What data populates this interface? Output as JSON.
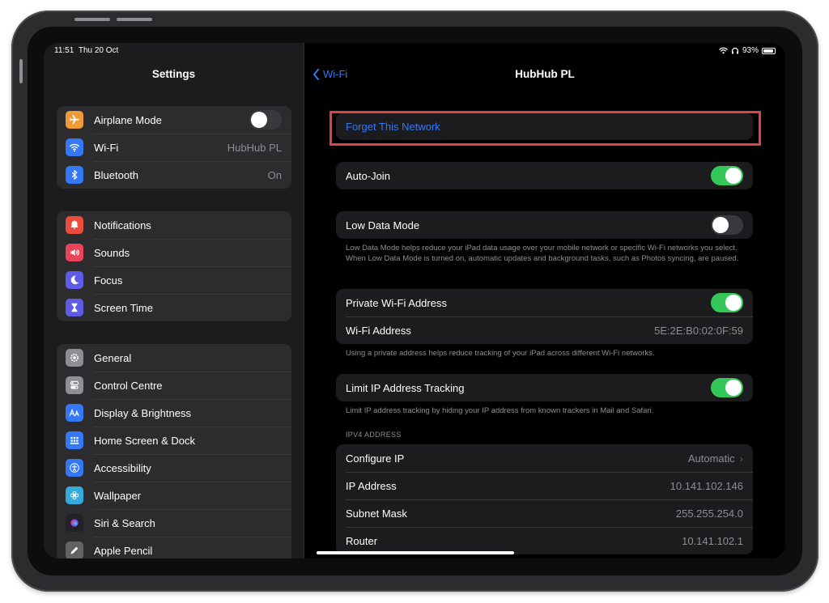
{
  "status_bar": {
    "time": "11:51",
    "date": "Thu 20 Oct",
    "battery": "93%"
  },
  "sidebar": {
    "title": "Settings",
    "groups": [
      [
        {
          "label": "Airplane Mode",
          "icon": "airplane-icon",
          "color": "#f09a37",
          "toggle": "off"
        },
        {
          "label": "Wi-Fi",
          "icon": "wifi-icon",
          "color": "#3478f6",
          "value": "HubHub PL"
        },
        {
          "label": "Bluetooth",
          "icon": "bluetooth-icon",
          "color": "#3478f6",
          "value": "On"
        }
      ],
      [
        {
          "label": "Notifications",
          "icon": "bell-icon",
          "color": "#eb4d3d"
        },
        {
          "label": "Sounds",
          "icon": "speaker-icon",
          "color": "#eb445a"
        },
        {
          "label": "Focus",
          "icon": "moon-icon",
          "color": "#5e5ce6"
        },
        {
          "label": "Screen Time",
          "icon": "hourglass-icon",
          "color": "#5e5ce6"
        }
      ],
      [
        {
          "label": "General",
          "icon": "gear-icon",
          "color": "#8e8e93"
        },
        {
          "label": "Control Centre",
          "icon": "switches-icon",
          "color": "#8e8e93"
        },
        {
          "label": "Display & Brightness",
          "icon": "text-size-icon",
          "color": "#3478f6"
        },
        {
          "label": "Home Screen & Dock",
          "icon": "grid-icon",
          "color": "#3478f6"
        },
        {
          "label": "Accessibility",
          "icon": "accessibility-icon",
          "color": "#3478f6"
        },
        {
          "label": "Wallpaper",
          "icon": "flower-icon",
          "color": "#35aadc"
        },
        {
          "label": "Siri & Search",
          "icon": "siri-icon",
          "color": "#222226"
        },
        {
          "label": "Apple Pencil",
          "icon": "pencil-icon",
          "color": "#636366"
        }
      ]
    ]
  },
  "detail": {
    "back_label": "Wi-Fi",
    "title": "HubHub PL",
    "forget_label": "Forget This Network",
    "auto_join": {
      "label": "Auto-Join",
      "toggle": "on"
    },
    "low_data": {
      "label": "Low Data Mode",
      "toggle": "off",
      "footnote": "Low Data Mode helps reduce your iPad data usage over your mobile network or specific Wi-Fi networks you select. When Low Data Mode is turned on, automatic updates and background tasks, such as Photos syncing, are paused."
    },
    "private": {
      "label": "Private Wi-Fi Address",
      "toggle": "on",
      "address_label": "Wi-Fi Address",
      "address_value": "5E:2E:B0:02:0F:59",
      "footnote": "Using a private address helps reduce tracking of your iPad across different Wi-Fi networks."
    },
    "limit_ip": {
      "label": "Limit IP Address Tracking",
      "toggle": "on",
      "footnote": "Limit IP address tracking by hiding your IP address from known trackers in Mail and Safari."
    },
    "ipv4": {
      "header": "IPV4 ADDRESS",
      "rows": [
        {
          "label": "Configure IP",
          "value": "Automatic"
        },
        {
          "label": "IP Address",
          "value": "10.141.102.146"
        },
        {
          "label": "Subnet Mask",
          "value": "255.255.254.0"
        },
        {
          "label": "Router",
          "value": "10.141.102.1"
        }
      ]
    }
  }
}
